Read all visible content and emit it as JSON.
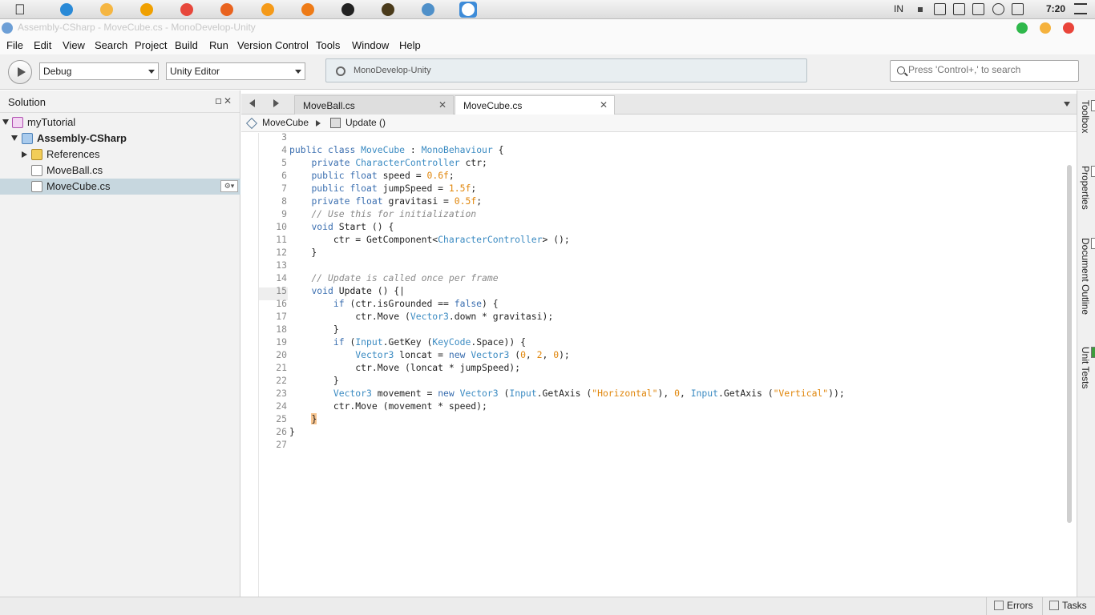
{
  "os_bar": {
    "apple_glyph": "",
    "apps": [
      {
        "name": "internet-explorer-icon",
        "color": "#2a8ad7"
      },
      {
        "name": "finder-icon",
        "color": "#f5b642"
      },
      {
        "name": "media-player-icon",
        "color": "#f0a000"
      },
      {
        "name": "chrome-icon",
        "color": "#e7473b"
      },
      {
        "name": "firefox-icon",
        "color": "#e9631f"
      },
      {
        "name": "firefox-alt-icon",
        "color": "#f59a19"
      },
      {
        "name": "blender-icon",
        "color": "#ee7b17"
      },
      {
        "name": "unity-icon",
        "color": "#222222"
      },
      {
        "name": "editor-icon",
        "color": "#4a3b1b"
      },
      {
        "name": "tools-icon",
        "color": "#4f90c9"
      },
      {
        "name": "monodevelop-icon",
        "color": "#ffffff"
      }
    ],
    "lang": "IN",
    "clock": "7:20"
  },
  "window": {
    "title": "Assembly-CSharp - MoveCube.cs - MonoDevelop-Unity",
    "colors": {
      "close": "#e9443a",
      "minimize": "#f5b23d",
      "maximize": "#2fb84b"
    }
  },
  "menu": [
    "File",
    "Edit",
    "View",
    "Search",
    "Project",
    "Build",
    "Run",
    "Version Control",
    "Tools",
    "Window",
    "Help"
  ],
  "toolbar": {
    "config": "Debug",
    "target": "Unity Editor",
    "status": "MonoDevelop-Unity",
    "search_placeholder": "Press 'Control+,' to search"
  },
  "solution_pad": {
    "title": "Solution",
    "tree": [
      {
        "label": "myTutorial",
        "bold": false
      },
      {
        "label": "Assembly-CSharp",
        "bold": true
      },
      {
        "label": "References",
        "bold": false
      },
      {
        "label": "MoveBall.cs",
        "bold": false
      },
      {
        "label": "MoveCube.cs",
        "bold": false
      }
    ]
  },
  "tabs": [
    {
      "label": "MoveBall.cs",
      "active": false
    },
    {
      "label": "MoveCube.cs",
      "active": true
    }
  ],
  "breadcrumb": {
    "class": "MoveCube",
    "method": "Update ()"
  },
  "editor": {
    "lines": [
      {
        "n": "3",
        "html": ""
      },
      {
        "n": "4",
        "html": "<span class='k'>public</span> <span class='k'>class</span> <span class='ty'>MoveCube</span> : <span class='ty'>MonoBehaviour</span> {"
      },
      {
        "n": "5",
        "html": "    <span class='k'>private</span> <span class='ty'>CharacterController</span> ctr;"
      },
      {
        "n": "6",
        "html": "    <span class='k'>public</span> <span class='k'>float</span> speed = <span class='n'>0.6f</span>;"
      },
      {
        "n": "7",
        "html": "    <span class='k'>public</span> <span class='k'>float</span> jumpSpeed = <span class='n'>1.5f</span>;"
      },
      {
        "n": "8",
        "html": "    <span class='k'>private</span> <span class='k'>float</span> gravitasi = <span class='n'>0.5f</span>;"
      },
      {
        "n": "9",
        "html": "    <span class='c'>// Use this for initialization</span>"
      },
      {
        "n": "10",
        "html": "    <span class='k'>void</span> Start () {"
      },
      {
        "n": "11",
        "html": "        ctr = GetComponent&lt;<span class='ty'>CharacterController</span>&gt; ();"
      },
      {
        "n": "12",
        "html": "    }"
      },
      {
        "n": "13",
        "html": ""
      },
      {
        "n": "14",
        "html": "    <span class='c'>// Update is called once per frame</span>"
      },
      {
        "n": "15",
        "html": "    <span class='k'>void</span> Update () {|"
      },
      {
        "n": "16",
        "html": "        <span class='k'>if</span> (ctr.isGrounded == <span class='k'>false</span>) {"
      },
      {
        "n": "17",
        "html": "            ctr.Move (<span class='ty'>Vector3</span>.down * gravitasi);"
      },
      {
        "n": "18",
        "html": "        }"
      },
      {
        "n": "19",
        "html": "        <span class='k'>if</span> (<span class='ty'>Input</span>.GetKey (<span class='ty'>KeyCode</span>.Space)) {"
      },
      {
        "n": "20",
        "html": "            <span class='ty'>Vector3</span> loncat = <span class='k'>new</span> <span class='ty'>Vector3</span> (<span class='n'>0</span>, <span class='n'>2</span>, <span class='n'>0</span>);"
      },
      {
        "n": "21",
        "html": "            ctr.Move (loncat * jumpSpeed);"
      },
      {
        "n": "22",
        "html": "        }"
      },
      {
        "n": "23",
        "html": "        <span class='ty'>Vector3</span> movement = <span class='k'>new</span> <span class='ty'>Vector3</span> (<span class='ty'>Input</span>.GetAxis (<span class='s'>\"Horizontal\"</span>), <span class='n'>0</span>, <span class='ty'>Input</span>.GetAxis (<span class='s'>\"Vertical\"</span>));"
      },
      {
        "n": "24",
        "html": "        ctr.Move (movement * speed);"
      },
      {
        "n": "25",
        "html": "    <span class='hl'>}</span>"
      },
      {
        "n": "26",
        "html": "}"
      },
      {
        "n": "27",
        "html": ""
      }
    ],
    "current_line": "15"
  },
  "right_pads": [
    "Toolbox",
    "Properties",
    "Document Outline",
    "Unit Tests"
  ],
  "statusbar": {
    "errors": "Errors",
    "tasks": "Tasks"
  }
}
